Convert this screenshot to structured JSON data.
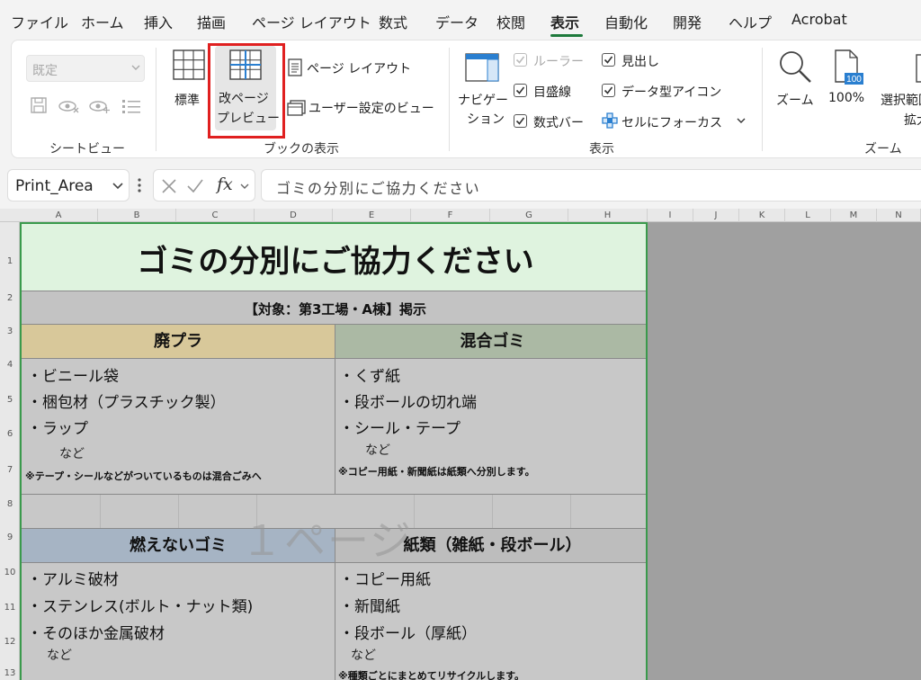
{
  "menu": {
    "tabs": [
      "ファイル",
      "ホーム",
      "挿入",
      "描画",
      "ページ レイアウト",
      "数式",
      "データ",
      "校閲",
      "表示",
      "自動化",
      "開発",
      "ヘルプ",
      "Acrobat"
    ],
    "active": "表示"
  },
  "ribbon": {
    "sheet_view": {
      "dropdown_value": "既定",
      "label": "シートビュー"
    },
    "workbook_view": {
      "normal": "標準",
      "page_break_preview_line1": "改ページ",
      "page_break_preview_line2": "プレビュー",
      "page_layout": "ページ レイアウト",
      "custom_views": "ユーザー設定のビュー",
      "label": "ブックの表示"
    },
    "show": {
      "navigation_line1": "ナビゲー",
      "navigation_line2": "ション",
      "ruler": "ルーラー",
      "gridlines": "目盛線",
      "formula_bar": "数式バー",
      "headings": "見出し",
      "data_type_icons": "データ型アイコン",
      "focus_cell": "セルにフォーカス",
      "label": "表示"
    },
    "zoom": {
      "zoom": "ズーム",
      "hundred": "100%",
      "icon_number": "100",
      "zoom_to_selection_line1": "選択範囲",
      "zoom_to_selection_line2": "拡大",
      "label": "ズーム"
    }
  },
  "formula_bar": {
    "name_box": "Print_Area",
    "fx": "fx",
    "content": "ゴミの分別にご協力ください"
  },
  "sheet": {
    "columns": [
      "A",
      "B",
      "C",
      "D",
      "E",
      "F",
      "G",
      "H",
      "I",
      "J",
      "K",
      "L",
      "M",
      "N"
    ],
    "rows": [
      "1",
      "2",
      "3",
      "4",
      "5",
      "6",
      "7",
      "8",
      "9",
      "10",
      "11",
      "12",
      "13"
    ],
    "page_watermark": "１ページ",
    "title": "ゴミの分別にご協力ください",
    "subtitle": "【対象：第3工場・A棟】掲示",
    "categories": [
      {
        "name": "廃プラ",
        "color": "#d8c89a",
        "items": [
          "・ビニール袋",
          "・梱包材（プラスチック製）",
          "・ラップ"
        ],
        "etc": "など",
        "note": "※テープ・シールなどがついているものは混合ごみへ"
      },
      {
        "name": "混合ゴミ",
        "color": "#abb9a4",
        "items": [
          "・くず紙",
          "・段ボールの切れ端",
          "・シール・テープ"
        ],
        "etc": "など",
        "note": "※コピー用紙・新聞紙は紙類へ分別します。"
      },
      {
        "name": "燃えないゴミ",
        "color": "#a6b4c4",
        "items": [
          "・アルミ破材",
          "・ステンレス(ボルト・ナット類)",
          "・そのほか金属破材"
        ],
        "etc": "など",
        "note": ""
      },
      {
        "name": "紙類（雑紙・段ボール）",
        "color": "#bdbdbd",
        "items": [
          "・コピー用紙",
          "・新聞紙",
          "・段ボール（厚紙）"
        ],
        "etc": "など",
        "note": "※種類ごとにまとめてリサイクルします。"
      }
    ],
    "colors": {
      "title_bg": "#dff3df",
      "subtitle_bg": "#c3c3c3",
      "page_border": "#3a9a4c",
      "highlight": "#e02020"
    }
  }
}
